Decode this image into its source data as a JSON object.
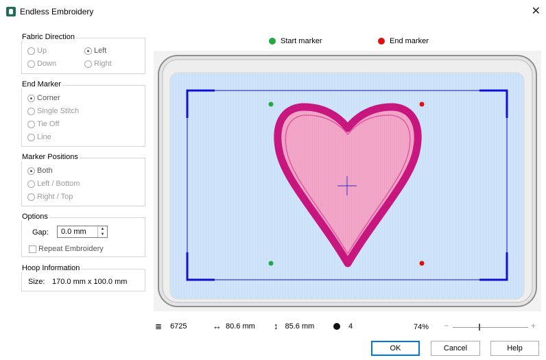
{
  "window": {
    "title": "Endless Embroidery",
    "close_glyph": "✕",
    "icon": "app-icon"
  },
  "fabric_direction": {
    "label": "Fabric Direction",
    "options": [
      "Up",
      "Left",
      "Down",
      "Right"
    ],
    "selected": "Left"
  },
  "end_marker": {
    "label": "End Marker",
    "options": [
      "Corner",
      "Single Stitch",
      "Tie Off",
      "Line"
    ],
    "selected": "Corner"
  },
  "marker_positions": {
    "label": "Marker Positions",
    "options": [
      "Both",
      "Left / Bottom",
      "Right / Top"
    ],
    "selected": "Both"
  },
  "options": {
    "label": "Options",
    "gap_label": "Gap:",
    "gap_value": "0.0 mm",
    "repeat_label": "Repeat Embroidery",
    "repeat_checked": false
  },
  "hoop": {
    "label": "Hoop Information",
    "size_label": "Size:",
    "size_value": "170.0 mm x 100.0 mm"
  },
  "markers_legend": {
    "start": "Start marker",
    "end": "End marker",
    "start_color": "#22aa44",
    "end_color": "#e01010"
  },
  "status": {
    "stitches": "6725",
    "width": "80.6 mm",
    "height": "85.6 mm",
    "colors": "4",
    "zoom": "74%",
    "zoom_level": 0.74
  },
  "buttons": {
    "ok": "OK",
    "cancel": "Cancel",
    "help": "Help"
  },
  "colors": {
    "heart_outline": "#c8167f",
    "heart_fill": "#f2a6c8",
    "fabric": "#cfe4fb",
    "frame": "#1010d0"
  }
}
